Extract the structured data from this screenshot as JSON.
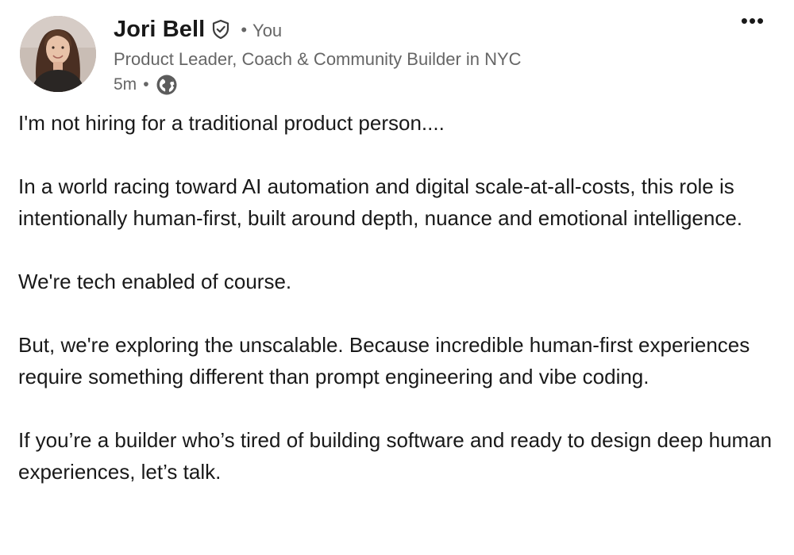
{
  "author": {
    "name": "Jori Bell",
    "degree_separator": "•",
    "degree": "You",
    "headline": "Product Leader, Coach & Community Builder in NYC",
    "timestamp": "5m",
    "meta_separator": "•",
    "visibility_icon": "globe-icon",
    "verified_icon": "verified-shield-icon"
  },
  "actions": {
    "more_icon": "more-horizontal-icon",
    "more_glyph": "•••"
  },
  "post": {
    "paragraphs": [
      "I'm not hiring for a traditional product person....",
      "In a world racing toward AI automation and digital scale-at-all-costs, this role is intentionally human-first, built around depth, nuance and emotional intelligence.",
      "We're tech enabled of course.",
      "But, we're exploring the unscalable. Because incredible human-first experiences require something different than prompt engineering and vibe coding.",
      "If you’re a builder who’s tired of building software and ready to design deep human experiences, let’s talk."
    ]
  },
  "colors": {
    "text_primary": "#191919",
    "text_secondary": "#666666",
    "background": "#ffffff"
  }
}
